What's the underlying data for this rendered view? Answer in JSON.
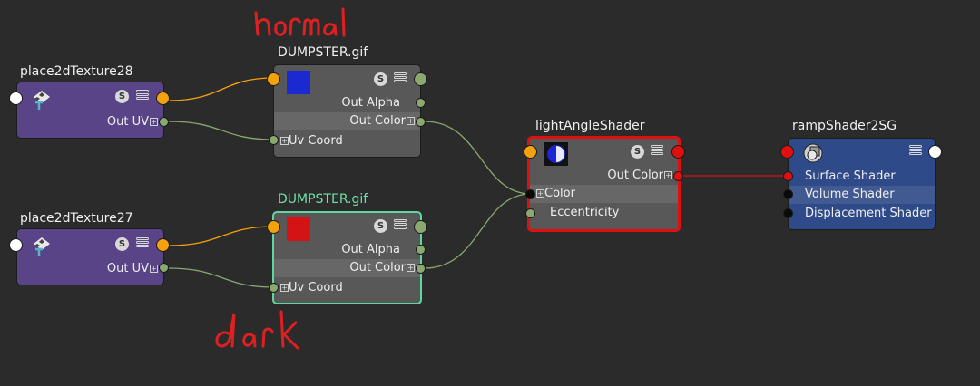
{
  "nodes": {
    "place28": {
      "title": "place2dTexture28",
      "out_uv": "Out UV"
    },
    "place27": {
      "title": "place2dTexture27",
      "out_uv": "Out UV"
    },
    "file_top": {
      "title": "DUMPSTER.gif",
      "out_alpha": "Out Alpha",
      "out_color": "Out Color",
      "uv_coord": "Uv Coord"
    },
    "file_bottom": {
      "title": "DUMPSTER.gif",
      "out_alpha": "Out Alpha",
      "out_color": "Out Color",
      "uv_coord": "Uv Coord"
    },
    "light_angle": {
      "title": "lightAngleShader",
      "out_color": "Out Color",
      "color": "Color",
      "eccentricity": "Eccentricity"
    },
    "ramp_sg": {
      "title": "rampShader2SG",
      "surface_shader": "Surface Shader",
      "volume_shader": "Volume Shader",
      "displacement_shader": "Displacement Shader"
    }
  },
  "annotations": {
    "top": "normal",
    "bottom": "dark"
  },
  "colors": {
    "background": "#2b2b2b",
    "place_node": "#5a4488",
    "file_node": "#585858",
    "shader_group": "#2f4a88",
    "selected_outline": "#5fd69e",
    "shader_outline": "#e01010",
    "color_port": "#f4a20c",
    "uv_port": "#8aa86f",
    "annotation": "#e02020"
  },
  "icons": [
    "s-icon",
    "menu-icon",
    "place2d-texture-icon",
    "shader-ball-icon",
    "shading-group-icon"
  ]
}
